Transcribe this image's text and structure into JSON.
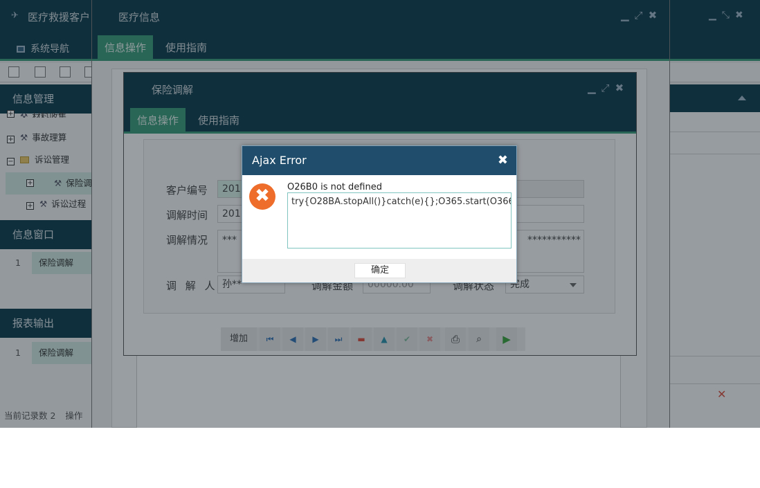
{
  "app": {
    "title": "医疗救援客户",
    "nav_tab": "系统导航"
  },
  "sidebar": {
    "info_mgmt": "信息管理",
    "tree": [
      {
        "label": "材料收集",
        "type": "leaf"
      },
      {
        "label": "事故理算",
        "type": "leaf"
      },
      {
        "label": "诉讼管理",
        "type": "folder"
      },
      {
        "label": "保险调解",
        "type": "leaf",
        "selected": true
      },
      {
        "label": "诉讼过程",
        "type": "leaf"
      }
    ],
    "info_window": "信息窗口",
    "window_rows": [
      {
        "num": "1",
        "name": "保险调解"
      }
    ],
    "report_output": "报表输出",
    "report_rows": [
      {
        "num": "1",
        "name": "保险调解"
      }
    ],
    "status": "当前记录数 2",
    "status_op": "操作"
  },
  "medical_window": {
    "title": "医疗信息",
    "tabs": [
      "信息操作",
      "使用指南"
    ]
  },
  "insurance_window": {
    "title": "保险调解",
    "tabs": [
      "信息操作",
      "使用指南"
    ],
    "fields": {
      "customer_no_label": "客户编号",
      "customer_no_value": "201",
      "time_label": "调解时间",
      "time_value": "201",
      "situation_label": "调解情况",
      "situation_value": "***",
      "situation_value_right": "***********",
      "mediator_label": "调 解 人",
      "mediator_value": "孙**",
      "amount_label": "调解金额",
      "amount_value": "00000.00",
      "state_label": "调解状态",
      "state_value": "完成"
    },
    "toolbar": {
      "add_label": "增加"
    }
  },
  "dialog": {
    "title": "Ajax Error",
    "message": "O26B0 is not defined",
    "detail": "try{O28BA.stopAll()}catch(e){};O365.start(O366);O36",
    "ok_label": "确定"
  },
  "colors": {
    "titlebar": "#0f3b4b",
    "accent_green": "#3a9a78",
    "dialog_title": "#1f4d6b",
    "error_orange": "#ee6d2a"
  }
}
